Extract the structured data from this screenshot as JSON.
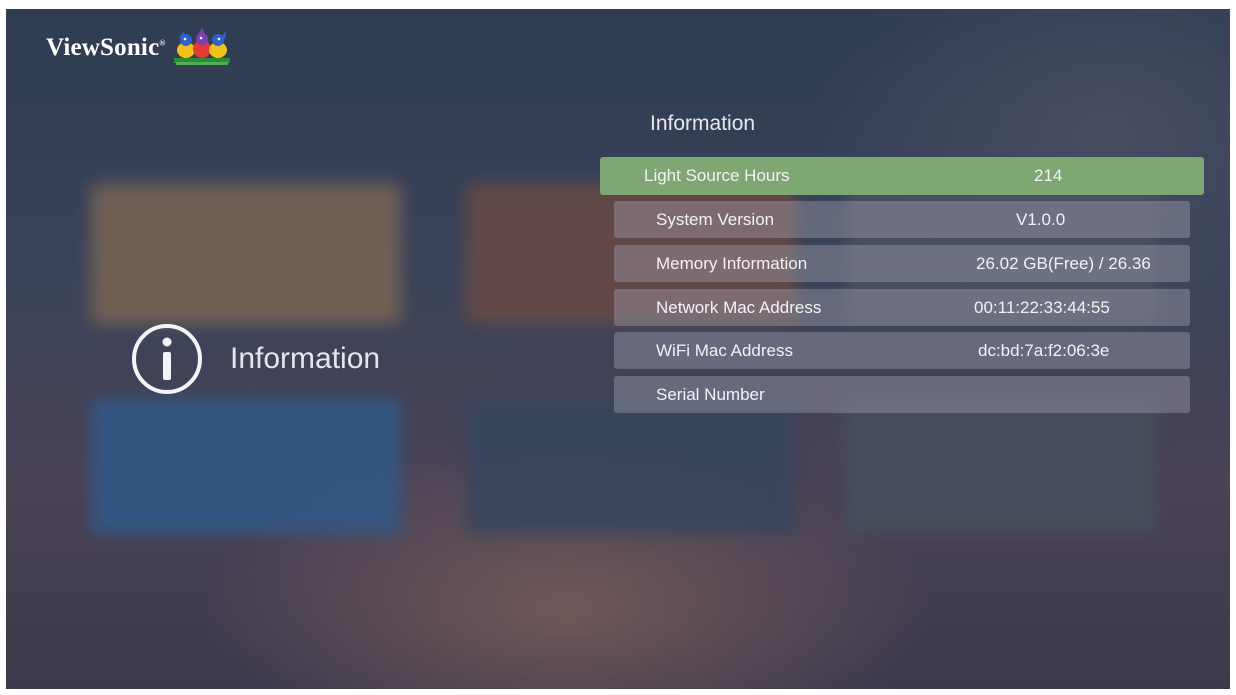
{
  "brand": {
    "name": "ViewSonic",
    "reg": "®"
  },
  "sidebar": {
    "title": "Information",
    "icon": "info-circle-icon"
  },
  "panel": {
    "title": "Information",
    "rows": [
      {
        "label": "Light Source Hours",
        "value": "214"
      },
      {
        "label": "System Version",
        "value": "V1.0.0"
      },
      {
        "label": "Memory Information",
        "value": "26.02 GB(Free) / 26.36"
      },
      {
        "label": "Network Mac Address",
        "value": "00:11:22:33:44:55"
      },
      {
        "label": "WiFi Mac Address",
        "value": "dc:bd:7a:f2:06:3e"
      },
      {
        "label": "Serial Number",
        "value": ""
      }
    ],
    "selected_index": 0
  },
  "colors": {
    "selected_row": "#7fa774",
    "row_bg": "rgba(160,160,175,0.42)",
    "text": "#f2f2f4"
  }
}
